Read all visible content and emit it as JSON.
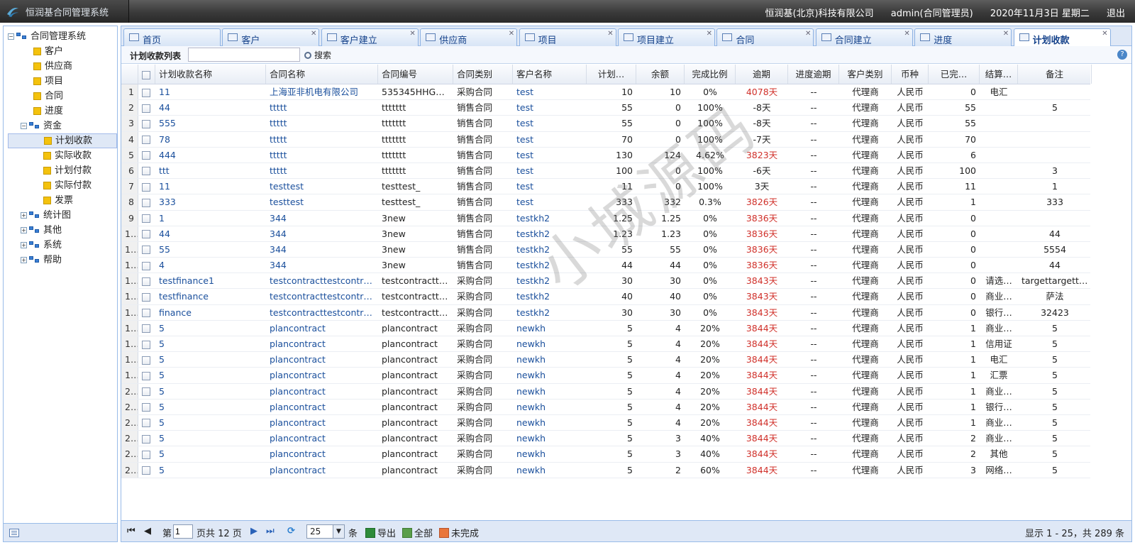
{
  "app": {
    "title": "恒润基合同管理系统"
  },
  "header": {
    "company": "恒润基(北京)科技有限公司",
    "user": "admin(合同管理员)",
    "date": "2020年11月3日 星期二",
    "logout": "退出"
  },
  "sidebar": {
    "root": "合同管理系统",
    "items": [
      "客户",
      "供应商",
      "项目",
      "合同",
      "进度"
    ],
    "fund": {
      "label": "资金",
      "children": [
        "计划收款",
        "实际收款",
        "计划付款",
        "实际付款",
        "发票"
      ]
    },
    "collapsed": [
      "统计图",
      "其他",
      "系统",
      "帮助"
    ]
  },
  "tabs": [
    "首页",
    "客户",
    "客户建立",
    "供应商",
    "项目",
    "项目建立",
    "合同",
    "合同建立",
    "进度",
    "计划收款"
  ],
  "toolbar": {
    "title": "计划收款列表",
    "search_value": "",
    "search_label": "搜索"
  },
  "columns": [
    "计划收款名称",
    "合同名称",
    "合同编号",
    "合同类别",
    "客户名称",
    "计划…",
    "余额",
    "完成比例",
    "逾期",
    "进度逾期",
    "客户类别",
    "币种",
    "已完…",
    "结算…",
    "备注"
  ],
  "rows": [
    [
      "11",
      "上海亚非机电有限公司",
      "535345HHGK…",
      "采购合同",
      "test",
      "10",
      "10",
      "0%",
      "4078天",
      "--",
      "代理商",
      "人民币",
      "0",
      "电汇",
      ""
    ],
    [
      "44",
      "ttttt",
      "ttttttt",
      "销售合同",
      "test",
      "55",
      "0",
      "100%",
      "-8天",
      "--",
      "代理商",
      "人民币",
      "55",
      "",
      "5"
    ],
    [
      "555",
      "ttttt",
      "ttttttt",
      "销售合同",
      "test",
      "55",
      "0",
      "100%",
      "-8天",
      "--",
      "代理商",
      "人民币",
      "55",
      "",
      ""
    ],
    [
      "78",
      "ttttt",
      "ttttttt",
      "销售合同",
      "test",
      "70",
      "0",
      "100%",
      "-7天",
      "--",
      "代理商",
      "人民币",
      "70",
      "",
      ""
    ],
    [
      "444",
      "ttttt",
      "ttttttt",
      "销售合同",
      "test",
      "130",
      "124",
      "4.62%",
      "3823天",
      "--",
      "代理商",
      "人民币",
      "6",
      "",
      ""
    ],
    [
      "ttt",
      "ttttt",
      "ttttttt",
      "销售合同",
      "test",
      "100",
      "0",
      "100%",
      "-6天",
      "--",
      "代理商",
      "人民币",
      "100",
      "",
      "3"
    ],
    [
      "11",
      "testtest",
      "testtest_",
      "销售合同",
      "test",
      "11",
      "0",
      "100%",
      "3天",
      "--",
      "代理商",
      "人民币",
      "11",
      "",
      "1"
    ],
    [
      "333",
      "testtest",
      "testtest_",
      "销售合同",
      "test",
      "333",
      "332",
      "0.3%",
      "3826天",
      "--",
      "代理商",
      "人民币",
      "1",
      "",
      "333"
    ],
    [
      "1",
      "344",
      "3new",
      "销售合同",
      "testkh2",
      "1.25",
      "1.25",
      "0%",
      "3836天",
      "--",
      "代理商",
      "人民币",
      "0",
      "",
      ""
    ],
    [
      "44",
      "344",
      "3new",
      "销售合同",
      "testkh2",
      "1.23",
      "1.23",
      "0%",
      "3836天",
      "--",
      "代理商",
      "人民币",
      "0",
      "",
      "44"
    ],
    [
      "55",
      "344",
      "3new",
      "销售合同",
      "testkh2",
      "55",
      "55",
      "0%",
      "3836天",
      "--",
      "代理商",
      "人民币",
      "0",
      "",
      "5554"
    ],
    [
      "4",
      "344",
      "3new",
      "销售合同",
      "testkh2",
      "44",
      "44",
      "0%",
      "3836天",
      "--",
      "代理商",
      "人民币",
      "0",
      "",
      "44"
    ],
    [
      "testfinance1",
      "testcontracttestcontract",
      "testcontracttes…",
      "采购合同",
      "testkh2",
      "30",
      "30",
      "0%",
      "3843天",
      "--",
      "代理商",
      "人民币",
      "0",
      "请选…",
      "targettargettar…"
    ],
    [
      "testfinance",
      "testcontracttestcontract",
      "testcontracttes…",
      "采购合同",
      "testkh2",
      "40",
      "40",
      "0%",
      "3843天",
      "--",
      "代理商",
      "人民币",
      "0",
      "商业…",
      "萨法"
    ],
    [
      "finance",
      "testcontracttestcontract",
      "testcontracttes…",
      "采购合同",
      "testkh2",
      "30",
      "30",
      "0%",
      "3843天",
      "--",
      "代理商",
      "人民币",
      "0",
      "银行…",
      "32423"
    ],
    [
      "5",
      "plancontract",
      "plancontract",
      "采购合同",
      "newkh",
      "5",
      "4",
      "20%",
      "3844天",
      "--",
      "代理商",
      "人民币",
      "1",
      "商业…",
      "5"
    ],
    [
      "5",
      "plancontract",
      "plancontract",
      "采购合同",
      "newkh",
      "5",
      "4",
      "20%",
      "3844天",
      "--",
      "代理商",
      "人民币",
      "1",
      "信用证",
      "5"
    ],
    [
      "5",
      "plancontract",
      "plancontract",
      "采购合同",
      "newkh",
      "5",
      "4",
      "20%",
      "3844天",
      "--",
      "代理商",
      "人民币",
      "1",
      "电汇",
      "5"
    ],
    [
      "5",
      "plancontract",
      "plancontract",
      "采购合同",
      "newkh",
      "5",
      "4",
      "20%",
      "3844天",
      "--",
      "代理商",
      "人民币",
      "1",
      "汇票",
      "5"
    ],
    [
      "5",
      "plancontract",
      "plancontract",
      "采购合同",
      "newkh",
      "5",
      "4",
      "20%",
      "3844天",
      "--",
      "代理商",
      "人民币",
      "1",
      "商业…",
      "5"
    ],
    [
      "5",
      "plancontract",
      "plancontract",
      "采购合同",
      "newkh",
      "5",
      "4",
      "20%",
      "3844天",
      "--",
      "代理商",
      "人民币",
      "1",
      "银行…",
      "5"
    ],
    [
      "5",
      "plancontract",
      "plancontract",
      "采购合同",
      "newkh",
      "5",
      "4",
      "20%",
      "3844天",
      "--",
      "代理商",
      "人民币",
      "1",
      "商业…",
      "5"
    ],
    [
      "5",
      "plancontract",
      "plancontract",
      "采购合同",
      "newkh",
      "5",
      "3",
      "40%",
      "3844天",
      "--",
      "代理商",
      "人民币",
      "2",
      "商业…",
      "5"
    ],
    [
      "5",
      "plancontract",
      "plancontract",
      "采购合同",
      "newkh",
      "5",
      "3",
      "40%",
      "3844天",
      "--",
      "代理商",
      "人民币",
      "2",
      "其他",
      "5"
    ],
    [
      "5",
      "plancontract",
      "plancontract",
      "采购合同",
      "newkh",
      "5",
      "2",
      "60%",
      "3844天",
      "--",
      "代理商",
      "人民币",
      "3",
      "网络…",
      "5"
    ]
  ],
  "pager": {
    "page_prefix": "第",
    "page": "1",
    "page_suffix": "页共 12 页",
    "page_size": "25",
    "size_suffix": "条",
    "export": "导出",
    "all": "全部",
    "unfinished": "未完成",
    "summary": "显示 1 - 25，共 289 条"
  },
  "watermark": "小城源码",
  "colors": {
    "header_dark": "#3a3a3a",
    "panel_border": "#99bbe8",
    "link": "#1a4f9c",
    "overdue": "#d0302a"
  }
}
